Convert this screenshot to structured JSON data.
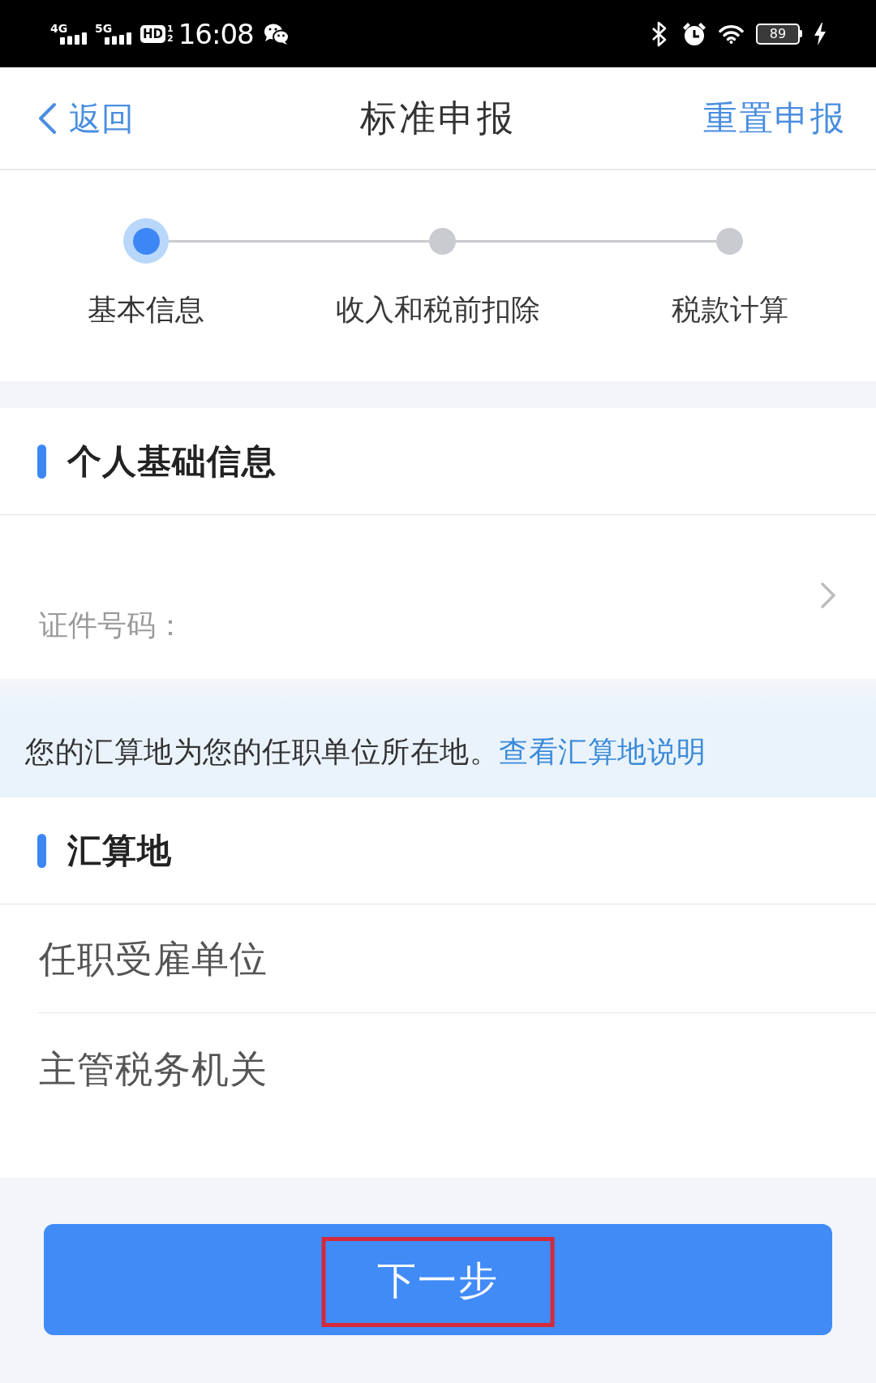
{
  "status_bar": {
    "networks": [
      {
        "type": "4G"
      },
      {
        "type": "5G"
      }
    ],
    "hd": "HD",
    "sim_slots": [
      "1",
      "2"
    ],
    "time": "16:08",
    "battery": "89"
  },
  "nav": {
    "back": "返回",
    "title": "标准申报",
    "action": "重置申报"
  },
  "steps": [
    {
      "label": "基本信息",
      "selected": true
    },
    {
      "label": "收入和税前扣除",
      "selected": false
    },
    {
      "label": "税款计算",
      "selected": false
    }
  ],
  "personal_section": {
    "title": "个人基础信息",
    "id_label": "证件号码："
  },
  "notice": {
    "text": "您的汇算地为您的任职单位所在地。",
    "link": "查看汇算地说明"
  },
  "settlement_section": {
    "title": "汇算地",
    "rows": [
      "任职受雇单位",
      "主管税务机关"
    ]
  },
  "next_button": {
    "label": "下一步",
    "highlighted": true
  }
}
